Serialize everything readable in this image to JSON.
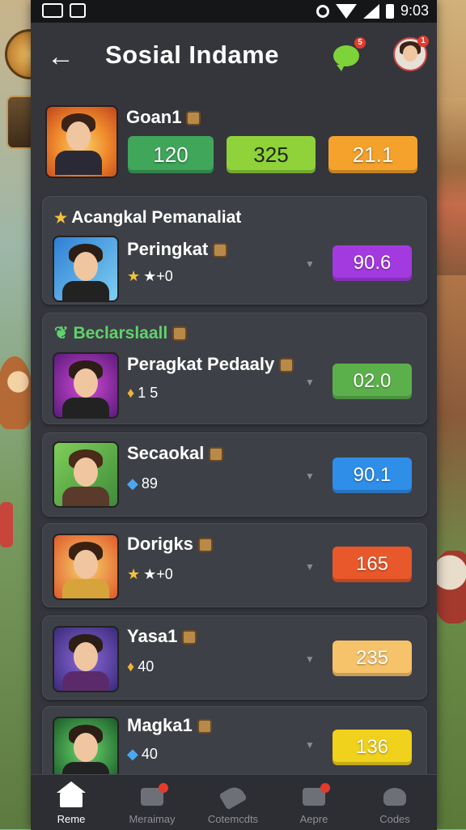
{
  "status_bar": {
    "time": "9:03"
  },
  "header": {
    "title": "Sosial Indame",
    "chat_badge": "5",
    "profile_badge": "1"
  },
  "top_player": {
    "name": "Goan1",
    "stats": [
      "120",
      "325",
      "21.1"
    ]
  },
  "sections": [
    {
      "label": "Acangkal Pemanaliat",
      "label_color": "#ffffff",
      "rows": [
        {
          "name": "Peringkat",
          "sub_icon": "star-icon",
          "sub_text": "★+0",
          "score": "90.6",
          "score_color": "#a33ae0"
        }
      ]
    },
    {
      "label": "Beclarslaall",
      "label_color": "#5fd36a",
      "rows": [
        {
          "name": "Peragkat Pedaaly",
          "sub_icon": "flame-icon",
          "sub_text": "1 5",
          "score": "02.0",
          "score_color": "#5cb04c"
        }
      ]
    }
  ],
  "rows": [
    {
      "name": "Secaokal",
      "sub_icon": "water-icon",
      "sub_text": "89",
      "score": "90.1",
      "score_color": "#2f8ee8"
    },
    {
      "name": "Dorigks",
      "sub_icon": "star-icon",
      "sub_text": "★+0",
      "score": "165",
      "score_color": "#e8582a"
    },
    {
      "name": "Yasa1",
      "sub_icon": "flame-icon",
      "sub_text": "40",
      "score": "235",
      "score_color": "#f6c36a"
    },
    {
      "name": "Magka1",
      "sub_icon": "water-icon",
      "sub_text": "40",
      "score": "136",
      "score_color": "#f0d21c"
    }
  ],
  "bottom_nav": [
    {
      "label": "Reme",
      "icon": "home-icon",
      "active": true
    },
    {
      "label": "Meraimay",
      "icon": "list-icon",
      "badge": true
    },
    {
      "label": "Cotemcdts",
      "icon": "tag-icon"
    },
    {
      "label": "Aepre",
      "icon": "inbox-icon",
      "badge": true
    },
    {
      "label": "Codes",
      "icon": "group-icon"
    }
  ]
}
